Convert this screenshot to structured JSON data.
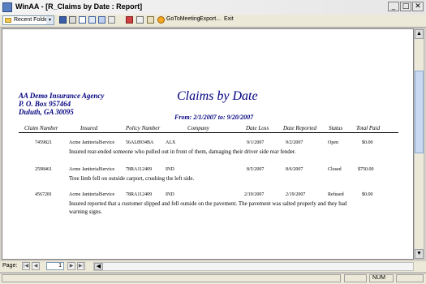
{
  "window": {
    "title": "WinAA - [R_Claims by Date : Report]",
    "min_glyph": "_",
    "max_glyph": "□",
    "close_glyph": "✕"
  },
  "toolbar": {
    "folder_select_value": "Recent Folders",
    "combo_arrow": "▾",
    "gotomeeting_label": "GoToMeeting",
    "export_label": "Export...",
    "exit_label": "Exit"
  },
  "report": {
    "company_lines": [
      "AA Demo Insurance Agency",
      "P. O. Box 957464",
      "Duluth, GA  30095"
    ],
    "title": "Claims by Date",
    "subtitle": "From: 2/1/2007 to: 9/20/2007",
    "columns": [
      "Claim Number",
      "Insured",
      "Policy Number",
      "Company",
      "Date Loss",
      "Date Reported",
      "Status",
      "Total Paid"
    ],
    "rows": [
      {
        "claim_number": "7459821",
        "insured": "Acme JanitorialService",
        "policy_number": "56AL8934BA",
        "company": "ALX",
        "date_loss": "9/1/2007",
        "date_reported": "9/2/2007",
        "status": "Open",
        "total_paid": "$0.00",
        "description": "Insured rear-ended someone who pulled out in front of them, damaging their driver side rear fender."
      },
      {
        "claim_number": "2598461",
        "insured": "Acme JanitorialService",
        "policy_number": "78RA112409",
        "company": "IND",
        "date_loss": "8/5/2007",
        "date_reported": "8/6/2007",
        "status": "Closed",
        "total_paid": "$750.00",
        "description": "Tree limb fell on outside carport, crushing the left side."
      },
      {
        "claim_number": "4567281",
        "insured": "Acme JanitorialService",
        "policy_number": "78RA112409",
        "company": "IND",
        "date_loss": "2/19/2007",
        "date_reported": "2/19/2007",
        "status": "Refused",
        "total_paid": "$0.00",
        "description": "Insured reported that a customer slipped and fell outside on the pavement. The pavement was salted properly and they had warning signs."
      }
    ]
  },
  "scrollbar": {
    "up_glyph": "▲",
    "down_glyph": "▼"
  },
  "page_nav": {
    "label": "Page:",
    "current_page": "1",
    "first_glyph": "|◀",
    "prev_glyph": "◀",
    "next_glyph": "▶",
    "last_glyph": "▶|",
    "hscroll_left_glyph": "◀"
  },
  "status": {
    "num_indicator": "NUM"
  },
  "icons": [
    "app-icon",
    "folder-icon",
    "print-icon",
    "page-icon",
    "two-pages-icon",
    "multi-page-icon",
    "close-report-icon",
    "tools-icon",
    "gotomeeting-icon"
  ]
}
